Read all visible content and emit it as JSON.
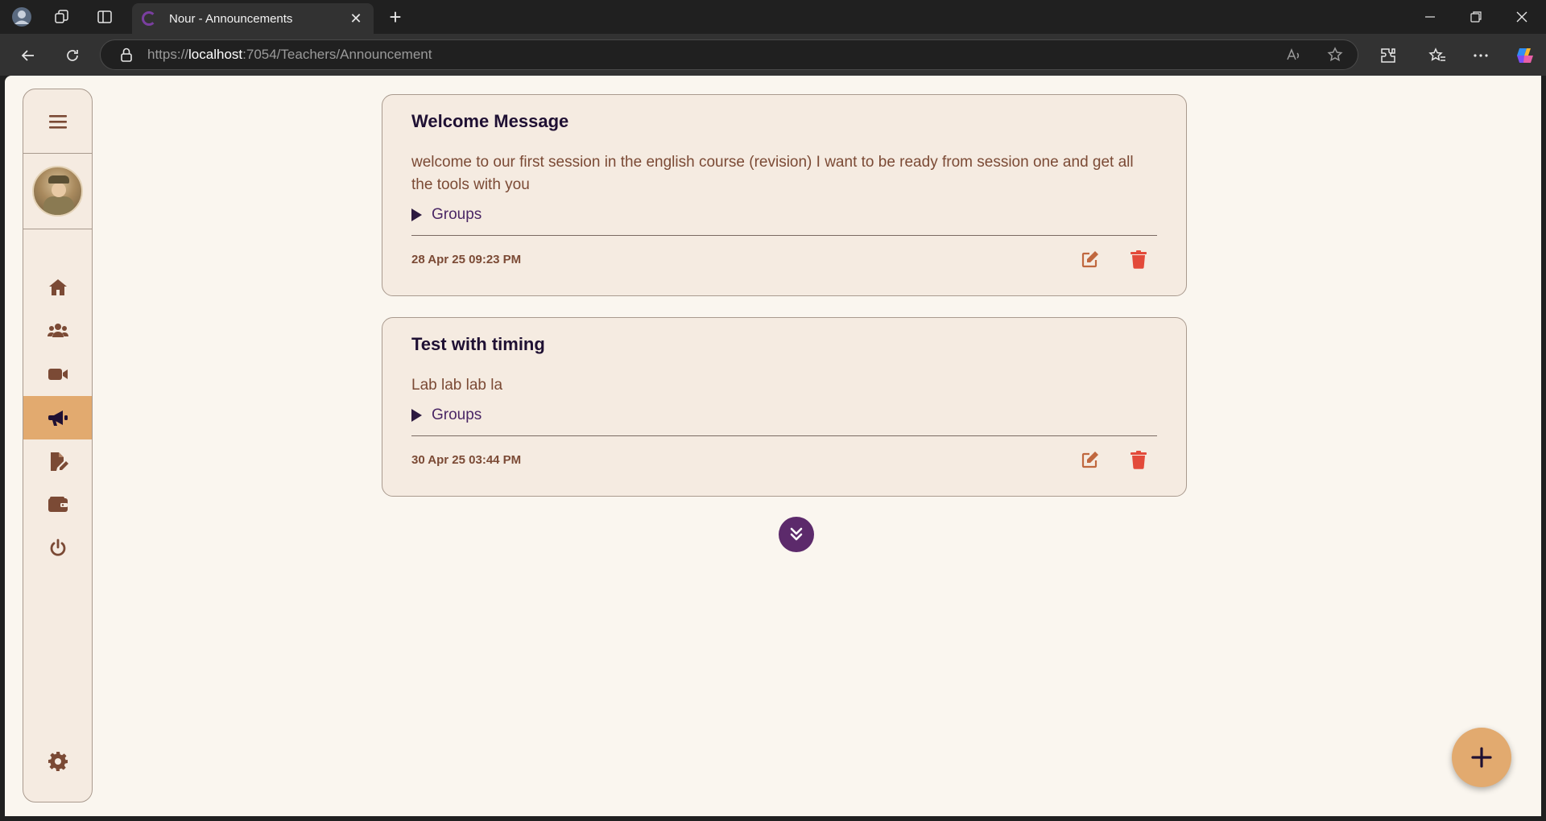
{
  "browser": {
    "tab_title": "Nour - Announcements",
    "tab_close": "✕",
    "new_tab": "+",
    "url_scheme": "https://",
    "url_host": "localhost",
    "url_rest": ":7054/Teachers/Announcement"
  },
  "sidebar": {
    "active_item": "announcements",
    "items": [
      "home",
      "groups",
      "sessions",
      "announcements",
      "assignments",
      "wallet",
      "logout"
    ],
    "bottom_item": "settings"
  },
  "announcements": [
    {
      "title": "Welcome Message",
      "body": "welcome to our first session in the english course (revision) I want to be ready from session one and get all the tools with you",
      "groups_label": "Groups",
      "date": "28 Apr 25 09:23 PM"
    },
    {
      "title": "Test with timing",
      "body": "Lab lab lab la",
      "groups_label": "Groups",
      "date": "30 Apr 25 03:44 PM"
    }
  ],
  "colors": {
    "page_bg": "#faf6ef",
    "card_bg": "#f5ebe1",
    "accent": "#e2aa6f",
    "brown": "#7b4a35",
    "purple": "#5c2a6b",
    "delete_red": "#e34a3a"
  },
  "icons": {
    "load_more": "double-chevron-down-icon",
    "fab": "plus-icon",
    "edit": "edit-icon",
    "delete": "trash-icon"
  }
}
